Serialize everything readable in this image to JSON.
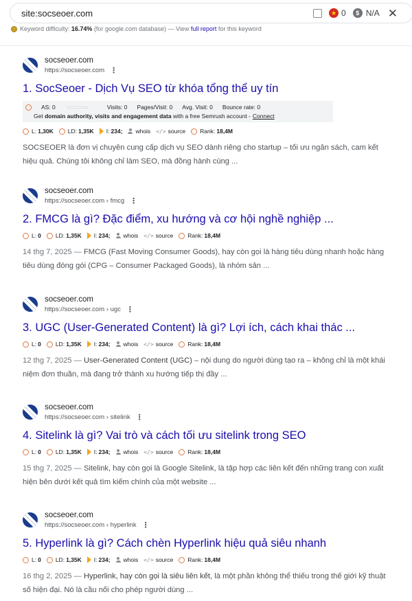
{
  "search": {
    "query": "site:socseoer.com",
    "checkbox_count": "0",
    "value_na": "N/A"
  },
  "keyword_difficulty": {
    "label": "Keyword difficulty:",
    "value": "16.74%",
    "note": "(for google.com database) — View",
    "link_text": "full report",
    "tail": "for this keyword"
  },
  "semrush": {
    "as": "AS: 0",
    "visits": "Visits: 0",
    "pages_visit": "Pages/Visit: 0",
    "avg_visit": "Avg. Visit: 0",
    "bounce": "Bounce rate: 0",
    "note_pre": "Get",
    "note_bold": "domain authority, visits and engagement data",
    "note_post": "with a free Semrush account -",
    "connect": "Connect"
  },
  "results": [
    {
      "site": "socseoer.com",
      "url": "https://socseoer.com",
      "title": "1. SocSeoer - Dịch Vụ SEO từ khóa tổng thể uy tín",
      "metrics": {
        "l": "1,30K",
        "ld": "1,35K",
        "i": "234;",
        "whois": "whois",
        "source": "source",
        "rank": "18,4M"
      },
      "date": "",
      "snippet_highlight": "",
      "snippet": "SOCSEOER là đơn vị chuyên cung cấp dịch vụ SEO dành riêng cho startup – tối ưu ngân sách, cam kết hiệu quả. Chúng tôi không chỉ làm SEO, mà đồng hành cùng ..."
    },
    {
      "site": "socseoer.com",
      "url": "https://socseoer.com › fmcg",
      "title": "2. FMCG là gì? Đặc điểm, xu hướng và cơ hội nghề nghiệp ...",
      "metrics": {
        "l": "0",
        "ld": "1,35K",
        "i": "234;",
        "whois": "whois",
        "source": "source",
        "rank": "18,4M"
      },
      "date": "14 thg 7, 2025 —",
      "snippet_highlight": "",
      "snippet": "FMCG (Fast Moving Consumer Goods), hay còn gọi là hàng tiêu dùng nhanh hoặc hàng tiêu dùng đóng gói (CPG – Consumer Packaged Goods), là nhóm sản ..."
    },
    {
      "site": "socseoer.com",
      "url": "https://socseoer.com › ugc",
      "title": "3. UGC (User-Generated Content) là gì? Lợi ích, cách khai thác ...",
      "metrics": {
        "l": "0",
        "ld": "1,35K",
        "i": "234;",
        "whois": "whois",
        "source": "source",
        "rank": "18,4M"
      },
      "date": "12 thg 7, 2025 —",
      "snippet_highlight": "User-Generated Content (UGC)",
      "snippet": "– nội dung do người dùng tạo ra – không chỉ là một khái niệm đơn thuần, mà đang trở thành xu hướng tiếp thị đầy ..."
    },
    {
      "site": "socseoer.com",
      "url": "https://socseoer.com › sitelink",
      "title": "4. Sitelink là gì? Vai trò và cách tối ưu sitelink trong SEO",
      "metrics": {
        "l": "0",
        "ld": "1,35K",
        "i": "234;",
        "whois": "whois",
        "source": "source",
        "rank": "18,4M"
      },
      "date": "15 thg 7, 2025 —",
      "snippet_highlight": "",
      "snippet": "Sitelink, hay còn gọi là Google Sitelink, là tập hợp các liên kết đến những trang con xuất hiện bên dưới kết quả tìm kiếm chính của một website ..."
    },
    {
      "site": "socseoer.com",
      "url": "https://socseoer.com › hyperlink",
      "title": "5. Hyperlink là gì? Cách chèn Hyperlink hiệu quả siêu nhanh",
      "metrics": {
        "l": "0",
        "ld": "1,35K",
        "i": "234;",
        "whois": "whois",
        "source": "source",
        "rank": "18,4M"
      },
      "date": "16 thg 2, 2025 —",
      "snippet_highlight": "Hyperlink, hay còn gọi là siêu liên kết,",
      "snippet": "là một phần không thể thiếu trong thế giới kỹ thuật số hiện đại. Nó là cầu nối cho phép người dùng ..."
    }
  ]
}
